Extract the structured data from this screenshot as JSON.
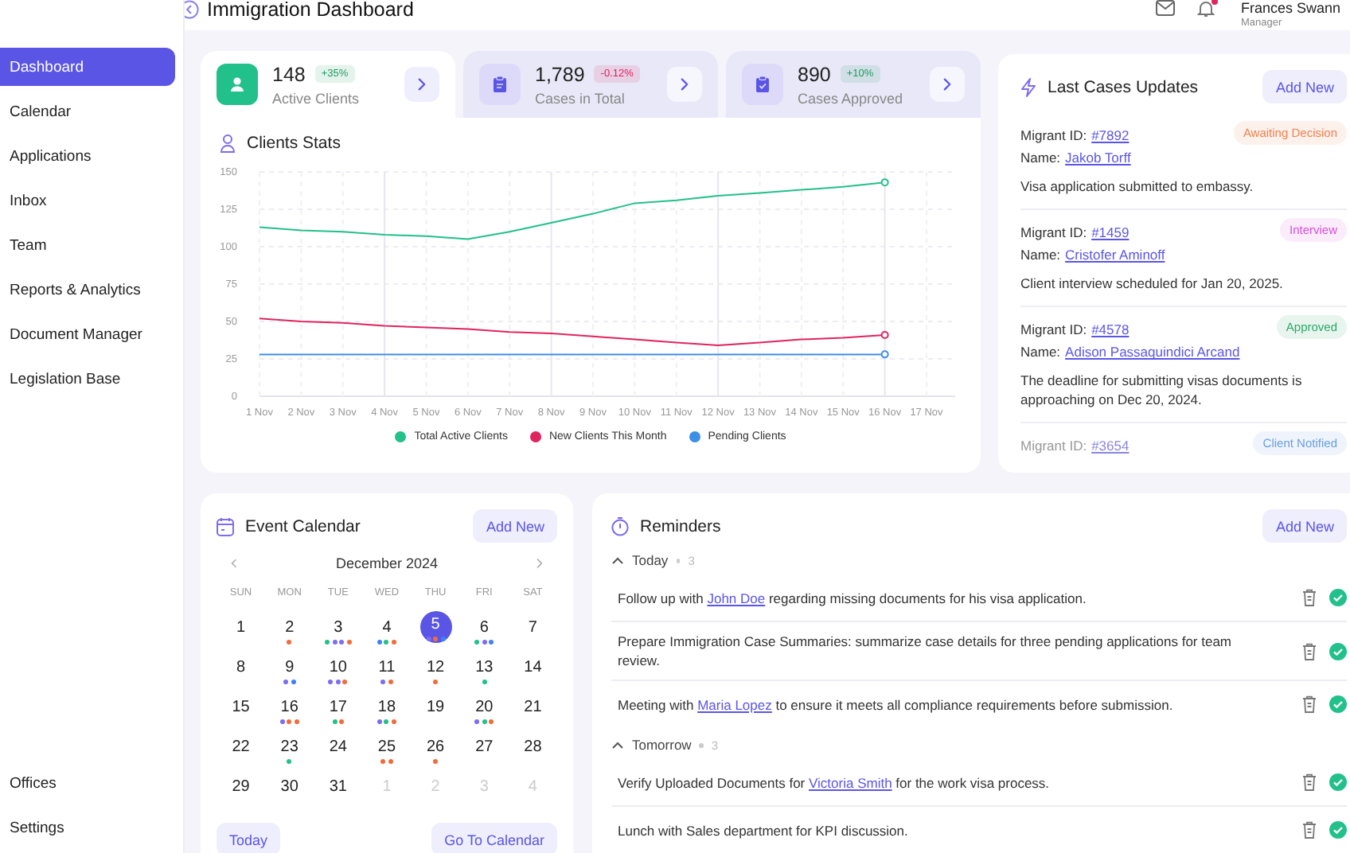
{
  "header": {
    "title": "Immigration Dashboard",
    "has_unread": true,
    "user": {
      "name": "Frances Swann",
      "role": "Manager"
    }
  },
  "sidebar": {
    "items": [
      {
        "label": "Dashboard",
        "selected": true
      },
      {
        "label": "Calendar",
        "selected": false
      },
      {
        "label": "Applications",
        "selected": false
      },
      {
        "label": "Inbox",
        "selected": false
      },
      {
        "label": "Team",
        "selected": false
      },
      {
        "label": "Reports & Analytics",
        "selected": false
      },
      {
        "label": "Document Manager",
        "selected": false
      },
      {
        "label": "Legislation Base",
        "selected": false
      }
    ],
    "bottom_items": [
      {
        "label": "Offices",
        "selected": false
      },
      {
        "label": "Settings",
        "selected": false
      }
    ]
  },
  "stats": [
    {
      "value": "148",
      "change": "+35%",
      "color": "#1f9d62",
      "label": "Active Clients",
      "selected": true
    },
    {
      "value": "1,789",
      "change": "-0.12%",
      "color": "#e0245e",
      "label": "Cases in Total",
      "selected": false
    },
    {
      "value": "890",
      "change": "+10%",
      "color": "#1f9d62",
      "label": "Cases Approved",
      "selected": false
    }
  ],
  "clients_stats": {
    "title": "Clients Stats",
    "chart_data": {
      "type": "line",
      "grid": true,
      "categories": [
        "1 Nov",
        "2 Nov",
        "3 Nov",
        "4 Nov",
        "5 Nov",
        "6 Nov",
        "7 Nov",
        "8 Nov",
        "9 Nov",
        "10 Nov",
        "11 Nov",
        "12 Nov",
        "13 Nov",
        "14 Nov",
        "15 Nov",
        "16 Nov",
        "17 Nov"
      ],
      "ylim": [
        0,
        150
      ],
      "yticks": [
        0,
        25,
        50,
        75,
        100,
        125,
        150
      ],
      "series": [
        {
          "name": "Total Active Clients",
          "color": "#22c08a",
          "values": [
            113,
            111,
            110,
            108,
            107,
            105,
            110,
            116,
            122,
            129,
            131,
            134,
            136,
            138,
            140,
            143,
            null
          ]
        },
        {
          "name": "New Clients This Month",
          "color": "#e0245e",
          "values": [
            52,
            50,
            49,
            47,
            46,
            45,
            43,
            42,
            40,
            38,
            36,
            34,
            36,
            38,
            39,
            41,
            null
          ]
        },
        {
          "name": "Pending Clients",
          "color": "#3b8fe8",
          "values": [
            28,
            28,
            28,
            28,
            28,
            28,
            28,
            28,
            28,
            28,
            28,
            28,
            28,
            28,
            28,
            28,
            null
          ]
        }
      ]
    }
  },
  "cases": {
    "title": "Last Cases Updates",
    "add_button": "Add New",
    "items": [
      {
        "id_label": "Migrant ID:",
        "id": "#7892",
        "name_label": "Name:",
        "name": "Jakob Torff",
        "status": "Awaiting Decision",
        "color": "#f0804f",
        "note": "Visa application submitted to embassy.",
        "faded": false
      },
      {
        "id_label": "Migrant ID:",
        "id": "#1459",
        "name_label": "Name:",
        "name": "Cristofer Aminoff",
        "status": "Interview",
        "color": "#d44fd8",
        "note": "Client interview scheduled for Jan 20, 2025.",
        "faded": false
      },
      {
        "id_label": "Migrant ID:",
        "id": "#4578",
        "name_label": "Name:",
        "name": "Adison Passaquindici Arcand",
        "status": "Approved",
        "color": "#2aa868",
        "note": "The deadline for submitting visas documents is approaching on Dec 20, 2024.",
        "faded": false
      },
      {
        "id_label": "Migrant ID:",
        "id": "#3654",
        "status": "Client Notified",
        "color": "#6a9fe0",
        "faded": true
      }
    ]
  },
  "calendar": {
    "title": "Event Calendar",
    "add_button": "Add New",
    "month": "December 2024",
    "weekdays": [
      "SUN",
      "MON",
      "TUE",
      "WED",
      "THU",
      "FRI",
      "SAT"
    ],
    "days": [
      {
        "day": "1",
        "outside": false,
        "selected": false
      },
      {
        "day": "2",
        "outside": false,
        "selected": false,
        "events": [
          {
            "color": "#f26b3a"
          }
        ]
      },
      {
        "day": "3",
        "outside": false,
        "selected": false,
        "events": [
          {
            "color": "#22c08a"
          },
          {
            "color": "#7b6cf0"
          },
          {
            "color": "#7b6cf0"
          },
          {
            "color": "#f26b3a"
          }
        ]
      },
      {
        "day": "4",
        "outside": false,
        "selected": false,
        "events": [
          {
            "color": "#3b82f6"
          },
          {
            "color": "#22c08a"
          },
          {
            "color": "#f26b3a"
          }
        ]
      },
      {
        "day": "5",
        "outside": false,
        "selected": true,
        "events": [
          {
            "color": "#7b6cf0"
          },
          {
            "color": "#f26b3a"
          },
          {
            "color": "#3b82f6"
          }
        ]
      },
      {
        "day": "6",
        "outside": false,
        "selected": false,
        "events": [
          {
            "color": "#22c08a"
          },
          {
            "color": "#7b6cf0"
          },
          {
            "color": "#3b82f6"
          }
        ]
      },
      {
        "day": "7",
        "outside": false,
        "selected": false
      },
      {
        "day": "8",
        "outside": false,
        "selected": false
      },
      {
        "day": "9",
        "outside": false,
        "selected": false,
        "events": [
          {
            "color": "#7b6cf0"
          },
          {
            "color": "#3b82f6"
          }
        ]
      },
      {
        "day": "10",
        "outside": false,
        "selected": false,
        "events": [
          {
            "color": "#7b6cf0"
          },
          {
            "color": "#7b6cf0"
          },
          {
            "color": "#f26b3a"
          }
        ]
      },
      {
        "day": "11",
        "outside": false,
        "selected": false,
        "events": [
          {
            "color": "#7b6cf0"
          },
          {
            "color": "#f26b3a"
          }
        ]
      },
      {
        "day": "12",
        "outside": false,
        "selected": false,
        "events": [
          {
            "color": "#f26b3a"
          }
        ]
      },
      {
        "day": "13",
        "outside": false,
        "selected": false,
        "events": [
          {
            "color": "#22c08a"
          }
        ]
      },
      {
        "day": "14",
        "outside": false,
        "selected": false
      },
      {
        "day": "15",
        "outside": false,
        "selected": false
      },
      {
        "day": "16",
        "outside": false,
        "selected": false,
        "events": [
          {
            "color": "#7b6cf0"
          },
          {
            "color": "#f26b3a"
          },
          {
            "color": "#f26b3a"
          }
        ]
      },
      {
        "day": "17",
        "outside": false,
        "selected": false,
        "events": [
          {
            "color": "#22c08a"
          },
          {
            "color": "#f26b3a"
          }
        ]
      },
      {
        "day": "18",
        "outside": false,
        "selected": false,
        "events": [
          {
            "color": "#7b6cf0"
          },
          {
            "color": "#22c08a"
          },
          {
            "color": "#f26b3a"
          }
        ]
      },
      {
        "day": "19",
        "outside": false,
        "selected": false
      },
      {
        "day": "20",
        "outside": false,
        "selected": false,
        "events": [
          {
            "color": "#7b6cf0"
          },
          {
            "color": "#22c08a"
          },
          {
            "color": "#f26b3a"
          }
        ]
      },
      {
        "day": "21",
        "outside": false,
        "selected": false
      },
      {
        "day": "22",
        "outside": false,
        "selected": false
      },
      {
        "day": "23",
        "outside": false,
        "selected": false,
        "events": [
          {
            "color": "#22c08a"
          }
        ]
      },
      {
        "day": "24",
        "outside": false,
        "selected": false
      },
      {
        "day": "25",
        "outside": false,
        "selected": false,
        "events": [
          {
            "color": "#f26b3a"
          },
          {
            "color": "#f26b3a"
          }
        ]
      },
      {
        "day": "26",
        "outside": false,
        "selected": false,
        "events": [
          {
            "color": "#f26b3a"
          }
        ]
      },
      {
        "day": "27",
        "outside": false,
        "selected": false
      },
      {
        "day": "28",
        "outside": false,
        "selected": false
      },
      {
        "day": "29",
        "outside": false,
        "selected": false
      },
      {
        "day": "30",
        "outside": false,
        "selected": false
      },
      {
        "day": "31",
        "outside": false,
        "selected": false
      },
      {
        "day": "1",
        "outside": true,
        "selected": false
      },
      {
        "day": "2",
        "outside": true,
        "selected": false
      },
      {
        "day": "3",
        "outside": true,
        "selected": false
      },
      {
        "day": "4",
        "outside": true,
        "selected": false
      }
    ],
    "buttons": [
      "Today",
      "Go To Calendar"
    ]
  },
  "reminders": {
    "title": "Reminders",
    "add_button": "Add New",
    "groups": [
      {
        "label": "Today",
        "count": "3",
        "expanded": true,
        "items": [
          {
            "before": "Follow up with ",
            "link": "John Doe",
            "after": " regarding missing documents for his visa application."
          },
          {
            "before": "Prepare Immigration Case Summaries: summarize case details for three pending applications for team review."
          },
          {
            "before": "Meeting with ",
            "link": "Maria Lopez",
            "after": " to ensure it meets all compliance requirements before submission."
          }
        ]
      },
      {
        "label": "Tomorrow",
        "count": "3",
        "expanded": true,
        "items": [
          {
            "before": "Verify Uploaded Documents for ",
            "link": "Victoria Smith",
            "after": " for the work visa process."
          },
          {
            "before": "Lunch with Sales department for KPI discussion."
          }
        ]
      }
    ]
  }
}
